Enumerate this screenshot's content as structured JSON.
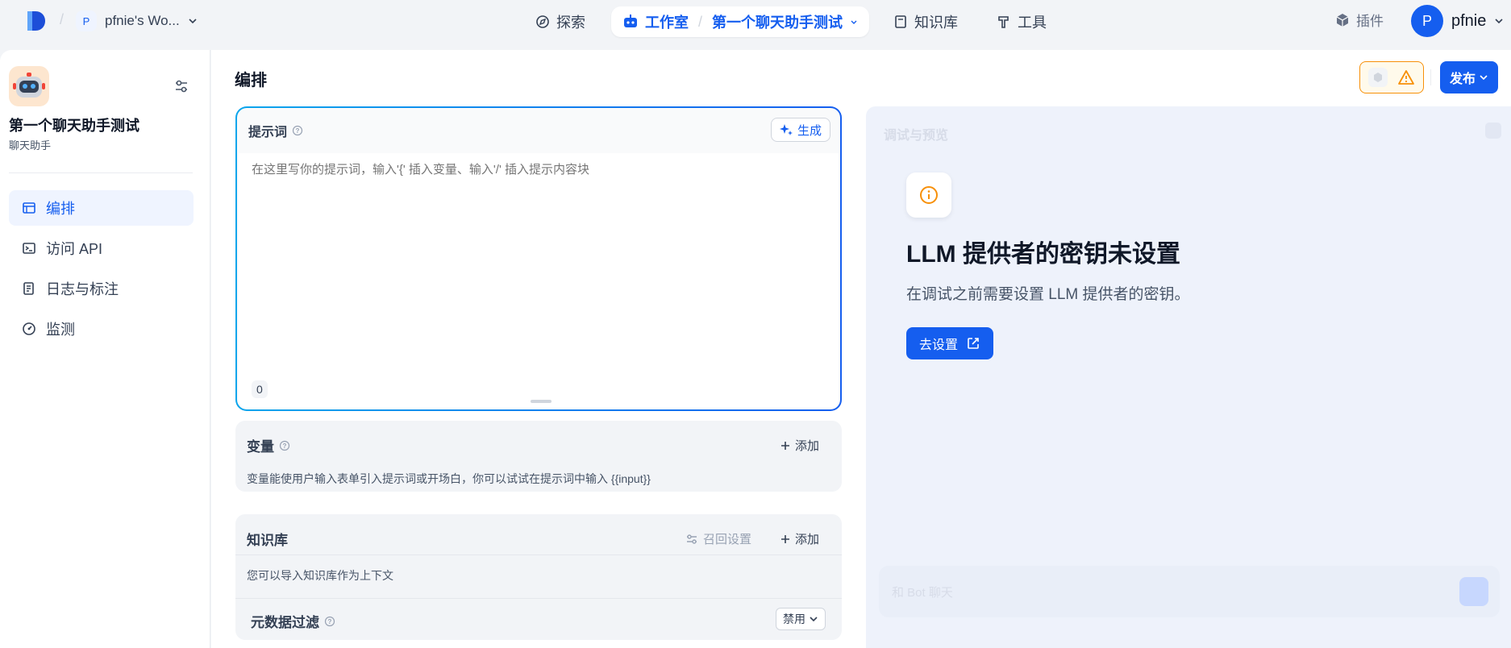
{
  "topnav": {
    "workspace_avatar": "P",
    "workspace_name": "pfnie's Wo...",
    "explore_label": "探索",
    "studio_label": "工作室",
    "app_name": "第一个聊天助手测试",
    "knowledge_label": "知识库",
    "tools_label": "工具",
    "plugin_label": "插件",
    "user_avatar": "P",
    "user_name": "pfnie"
  },
  "sidebar": {
    "app_title": "第一个聊天助手测试",
    "app_type": "聊天助手",
    "items": [
      {
        "label": "编排",
        "icon": "layout-icon",
        "active": true
      },
      {
        "label": "访问 API",
        "icon": "terminal-icon",
        "active": false
      },
      {
        "label": "日志与标注",
        "icon": "log-icon",
        "active": false
      },
      {
        "label": "监测",
        "icon": "gauge-icon",
        "active": false
      }
    ]
  },
  "main": {
    "title": "编排",
    "publish_label": "发布",
    "prompt": {
      "label": "提示词",
      "generate_label": "生成",
      "placeholder": "在这里写你的提示词，输入'{' 插入变量、输入'/' 插入提示内容块",
      "value": "",
      "char_count": "0"
    },
    "variables": {
      "title": "变量",
      "add_label": "添加",
      "description": "变量能使用户输入表单引入提示词或开场白，你可以试试在提示词中输入 {{input}}"
    },
    "knowledge": {
      "title": "知识库",
      "recall_label": "召回设置",
      "add_label": "添加",
      "description": "您可以导入知识库作为上下文",
      "metadata_filter_label": "元数据过滤",
      "metadata_filter_value": "禁用"
    }
  },
  "debug": {
    "title": "调试与预览",
    "input_placeholder": "和 Bot 聊天",
    "alert_title": "LLM 提供者的密钥未设置",
    "alert_description": "在调试之前需要设置 LLM 提供者的密钥。",
    "go_settings_label": "去设置"
  },
  "colors": {
    "primary": "#155eef",
    "warning": "#f79009",
    "background": "#f2f4f7"
  }
}
